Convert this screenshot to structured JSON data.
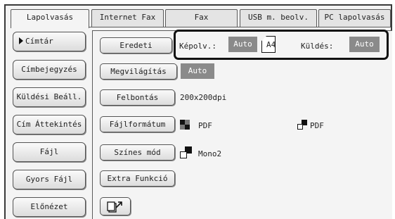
{
  "tabs": [
    {
      "label": "Lapolvasás",
      "active": true
    },
    {
      "label": "Internet Fax",
      "active": false
    },
    {
      "label": "Fax",
      "active": false
    },
    {
      "label": "USB m. beolv.",
      "active": false
    },
    {
      "label": "PC lapolvasás",
      "active": false
    }
  ],
  "sidebar": {
    "items": [
      {
        "label": "Címtár",
        "selected": true
      },
      {
        "label": "Címbejegyzés"
      },
      {
        "label": "Küldési Beáll."
      },
      {
        "label": "Cím Áttekintés"
      },
      {
        "label": "Fájl"
      },
      {
        "label": "Gyors Fájl"
      },
      {
        "label": "Előnézet"
      }
    ]
  },
  "main": {
    "eredeti": {
      "button": "Eredeti",
      "kepolv_label": "Képolv.:",
      "kepolv_value": "Auto",
      "paper_size": "A4",
      "kuldes_label": "Küldés:",
      "kuldes_value": "Auto"
    },
    "megvilagitas": {
      "button": "Megvilágítás",
      "value": "Auto"
    },
    "felbontas": {
      "button": "Felbontás",
      "value": "200x200dpi"
    },
    "fajlformatum": {
      "button": "Fájlformátum",
      "color_format": "PDF",
      "mono_format": "PDF"
    },
    "szines_mod": {
      "button": "Színes mód",
      "value": "Mono2"
    },
    "extra": {
      "button": "Extra Funkció"
    }
  },
  "icons": {
    "color_mode": "color-mode-icon",
    "mono_mode": "mono-mode-icon",
    "paper": "paper-icon",
    "program": "program-icon"
  },
  "colors": {
    "auto_badge_bg": "#8a8a8a",
    "frame": "#3a3a3a"
  }
}
